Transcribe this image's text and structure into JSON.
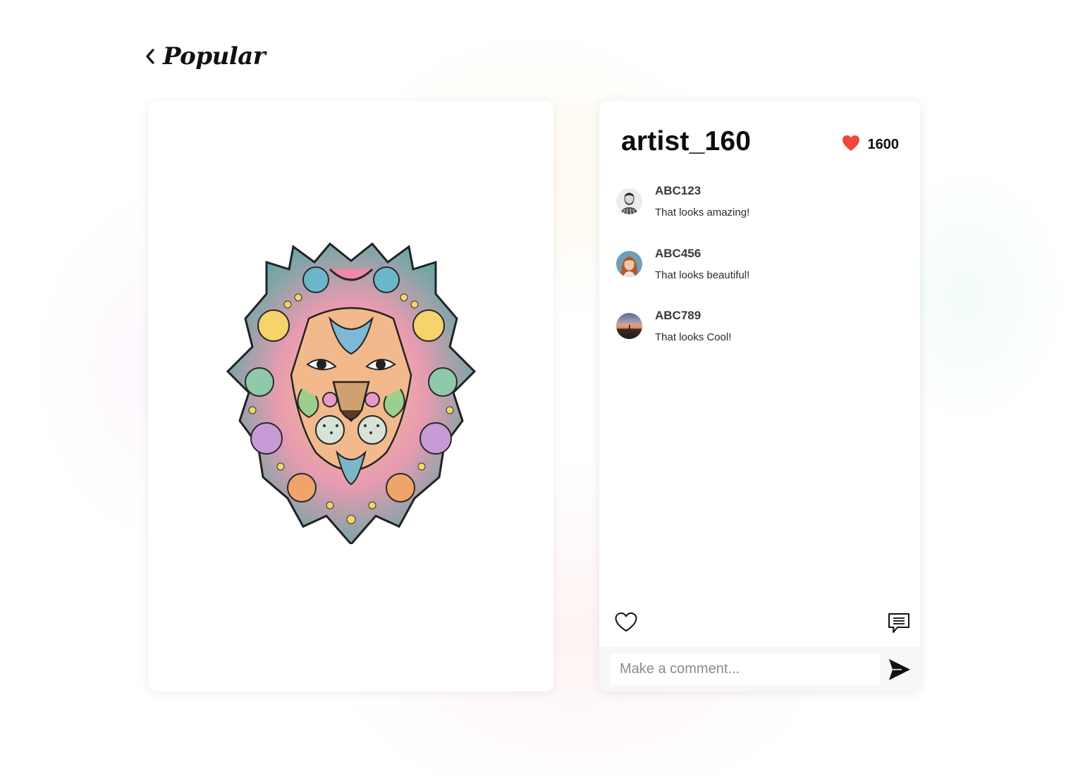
{
  "header": {
    "back_icon": "chevron-left-icon",
    "title": "Popular"
  },
  "artwork": {
    "subject": "lion-mandala-illustration"
  },
  "post": {
    "artist": "artist_160",
    "likes": "1600",
    "like_icon": "heart-filled-icon",
    "like_color": "#f0473c"
  },
  "comments": [
    {
      "user": "ABC123",
      "text": "That looks amazing!",
      "avatar": "avatar-man-bw"
    },
    {
      "user": "ABC456",
      "text": "That looks beautiful!",
      "avatar": "avatar-woman-red-hair"
    },
    {
      "user": "ABC789",
      "text": "That looks Cool!",
      "avatar": "avatar-sunset"
    }
  ],
  "actions": {
    "like_icon": "heart-outline-icon",
    "comment_icon": "comment-bubble-icon"
  },
  "composer": {
    "placeholder": "Make a comment...",
    "send_icon": "send-icon"
  }
}
